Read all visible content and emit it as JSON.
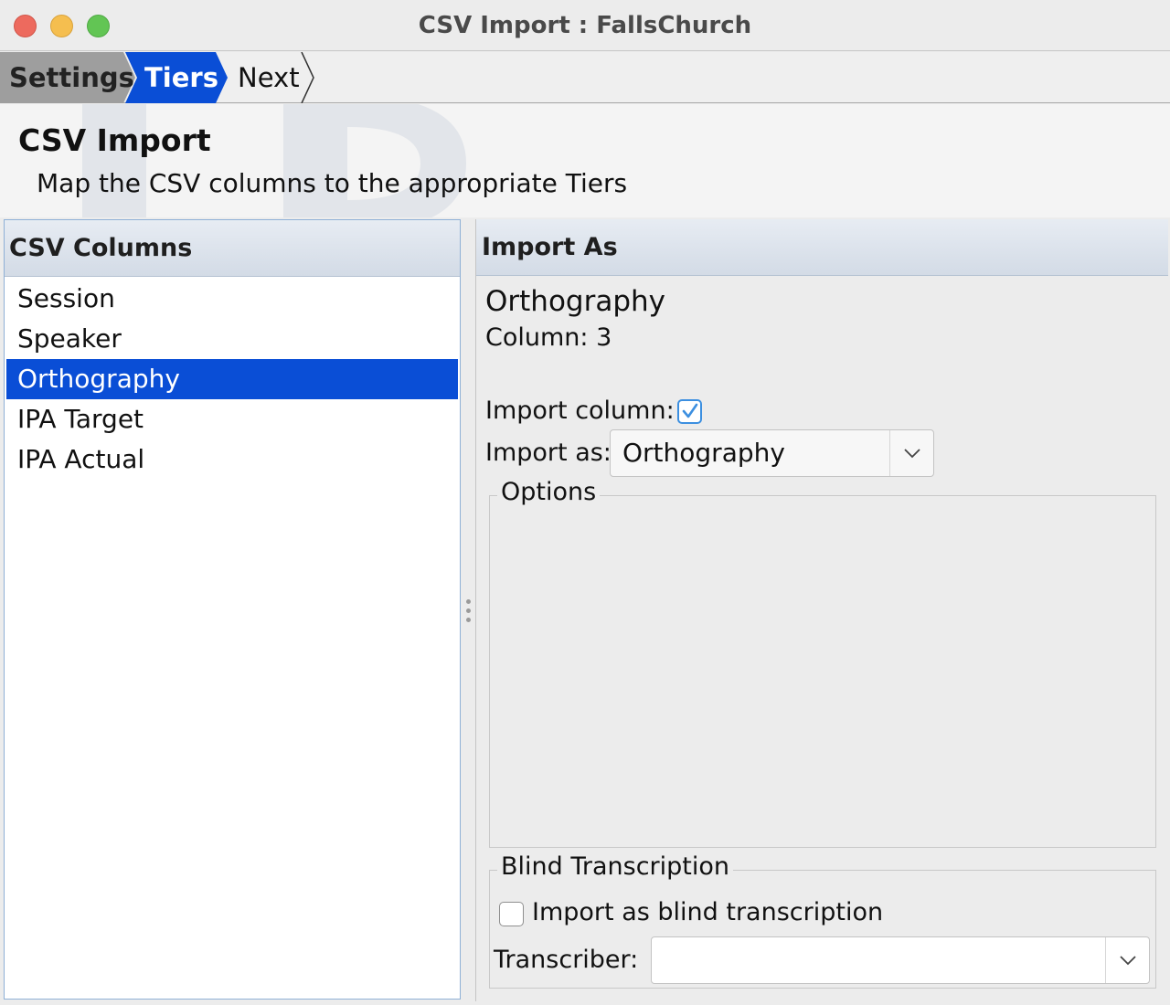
{
  "window": {
    "title": "CSV Import : FallsChurch"
  },
  "breadcrumb": {
    "steps": [
      {
        "label": "Settings",
        "state": "completed"
      },
      {
        "label": "Tiers",
        "state": "current"
      },
      {
        "label": "Next",
        "state": "upcoming"
      }
    ]
  },
  "header": {
    "title": "CSV Import",
    "subtitle": "Map the CSV columns to the appropriate Tiers"
  },
  "csv_columns": {
    "header": "CSV Columns",
    "items": [
      "Session",
      "Speaker",
      "Orthography",
      "IPA Target",
      "IPA Actual"
    ],
    "selected": "Orthography"
  },
  "import_as": {
    "header": "Import As",
    "field_name": "Orthography",
    "column_text": "Column: 3",
    "import_column_label": "Import column:",
    "import_column_checked": true,
    "import_as_label": "Import as:",
    "import_as_value": "Orthography",
    "options_group_title": "Options",
    "blind": {
      "group_title": "Blind Transcription",
      "checkbox_label": "Import as blind transcription",
      "checked": false,
      "transcriber_label": "Transcriber:",
      "transcriber_value": ""
    }
  },
  "colors": {
    "accent_blue": "#0a4ed6",
    "crumb_completed": "#9e9e9e",
    "checkbox_blue": "#3c8fe0"
  },
  "icons": {
    "dropdown": "chevron-down-icon",
    "check": "checkmark-icon"
  }
}
